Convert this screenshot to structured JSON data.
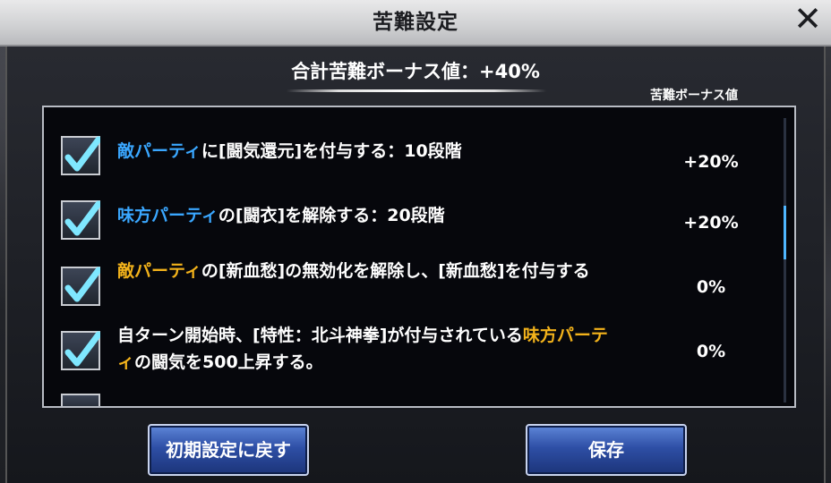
{
  "dialog": {
    "title": "苦難設定",
    "total_label": "合計苦難ボーナス値：+40%",
    "column_header": "苦難ボーナス値"
  },
  "rows": [
    {
      "checked": true,
      "parts": [
        {
          "text": "敵パーティ",
          "color": "blue"
        },
        {
          "text": "に[闘気還元]を付与する：10段階"
        }
      ],
      "value": "+20%"
    },
    {
      "checked": true,
      "parts": [
        {
          "text": "味方パーティ",
          "color": "blue"
        },
        {
          "text": "の[闘衣]を解除する：20段階"
        }
      ],
      "value": "+20%"
    },
    {
      "checked": true,
      "parts": [
        {
          "text": "敵パーティ",
          "color": "orange"
        },
        {
          "text": "の[新血愁]の無効化を解除し、[新血愁]を付与する"
        }
      ],
      "value": "0%"
    },
    {
      "checked": true,
      "parts": [
        {
          "text": "自ターン開始時、[特性：北斗神拳]が付与されている"
        },
        {
          "text": "味方パーティ",
          "color": "orange"
        },
        {
          "text": "の闘気を500上昇する。"
        }
      ],
      "value": "0%"
    }
  ],
  "buttons": {
    "reset": "初期設定に戻す",
    "save": "保存"
  },
  "icons": {
    "close": "close-icon",
    "check": "checkmark-icon"
  },
  "colors": {
    "accent_blue": "#3aa7ff",
    "accent_orange": "#f2b21b",
    "button_blue": "#2e4fa6"
  }
}
